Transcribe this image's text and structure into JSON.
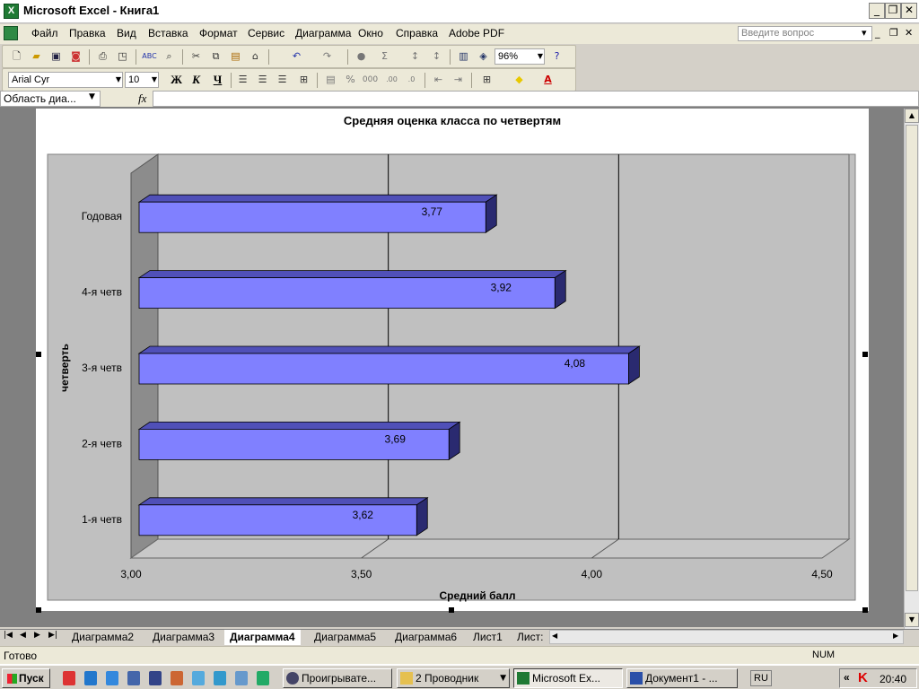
{
  "window": {
    "title": "Microsoft Excel - Книга1",
    "app_icon": "excel-icon",
    "controls": [
      "minimize",
      "restore",
      "close"
    ]
  },
  "menu": {
    "items": [
      "Файл",
      "Правка",
      "Вид",
      "Вставка",
      "Формат",
      "Сервис",
      "Диаграмма",
      "Окно",
      "Справка",
      "Adobe PDF"
    ],
    "help_placeholder": "Введите вопрос"
  },
  "toolbar_standard": {
    "zoom": "96%",
    "icons": [
      "new-icon",
      "open-icon",
      "save-icon",
      "permission-icon",
      "print-icon",
      "print-preview-icon",
      "spelling-icon",
      "research-icon",
      "cut-icon",
      "copy-icon",
      "paste-icon",
      "format-painter-icon",
      "undo-icon",
      "redo-icon",
      "hyperlink-icon",
      "autosum-icon",
      "sort-ascending-icon",
      "sort-descending-icon",
      "chart-wizard-icon",
      "drawing-icon",
      "help-icon"
    ]
  },
  "toolbar_formatting": {
    "font": "Arial Cyr",
    "size": "10",
    "bold": "Ж",
    "italic": "К",
    "underline": "Ч",
    "icons": [
      "align-left-icon",
      "align-center-icon",
      "align-right-icon",
      "merge-icon",
      "currency-icon",
      "percent-icon",
      "thousands-icon",
      "increase-decimal-icon",
      "decrease-decimal-icon",
      "decrease-indent-icon",
      "increase-indent-icon",
      "borders-icon",
      "fill-color-icon",
      "font-color-icon"
    ]
  },
  "formula_bar": {
    "name_box": "Область диа...",
    "fx": "fx",
    "value": ""
  },
  "chart_data": {
    "type": "bar",
    "orientation": "horizontal",
    "style": "3d-bar",
    "title": "Средняя оценка класса по четвертям",
    "xlabel": "Средний балл",
    "ylabel": "четверть",
    "categories": [
      "1-я четв",
      "2-я четв",
      "3-я четв",
      "4-я четв",
      "Годовая"
    ],
    "values": [
      3.62,
      3.69,
      4.08,
      3.92,
      3.77
    ],
    "data_labels": [
      "3,62",
      "3,69",
      "4,08",
      "3,92",
      "3,77"
    ],
    "xlim": [
      3.0,
      4.5
    ],
    "x_ticks": [
      "3,00",
      "3,50",
      "4,00",
      "4,50"
    ],
    "x_tick_values": [
      3.0,
      3.5,
      4.0,
      4.5
    ],
    "grid": true,
    "legend": "none",
    "colors": {
      "bar_front": "#8080ff",
      "bar_top": "#5050b8",
      "bar_side": "#2a2a70",
      "plot_bg": "#c0c0c0",
      "wall_left": "#8c8c8c"
    }
  },
  "sheet_tabs": {
    "tabs": [
      "Диаграмма2",
      "Диаграмма3",
      "Диаграмма4",
      "Диаграмма5",
      "Диаграмма6",
      "Лист1",
      "Лист:"
    ],
    "active": "Диаграмма4"
  },
  "status_bar": {
    "text": "Готово",
    "num": "NUM"
  },
  "taskbar": {
    "start": "Пуск",
    "tasks": [
      "Проигрывате...",
      "2 Проводник",
      "Microsoft Ex...",
      "Документ1 - ..."
    ],
    "active_task": "Microsoft Ex...",
    "language": "RU",
    "time": "20:40"
  }
}
